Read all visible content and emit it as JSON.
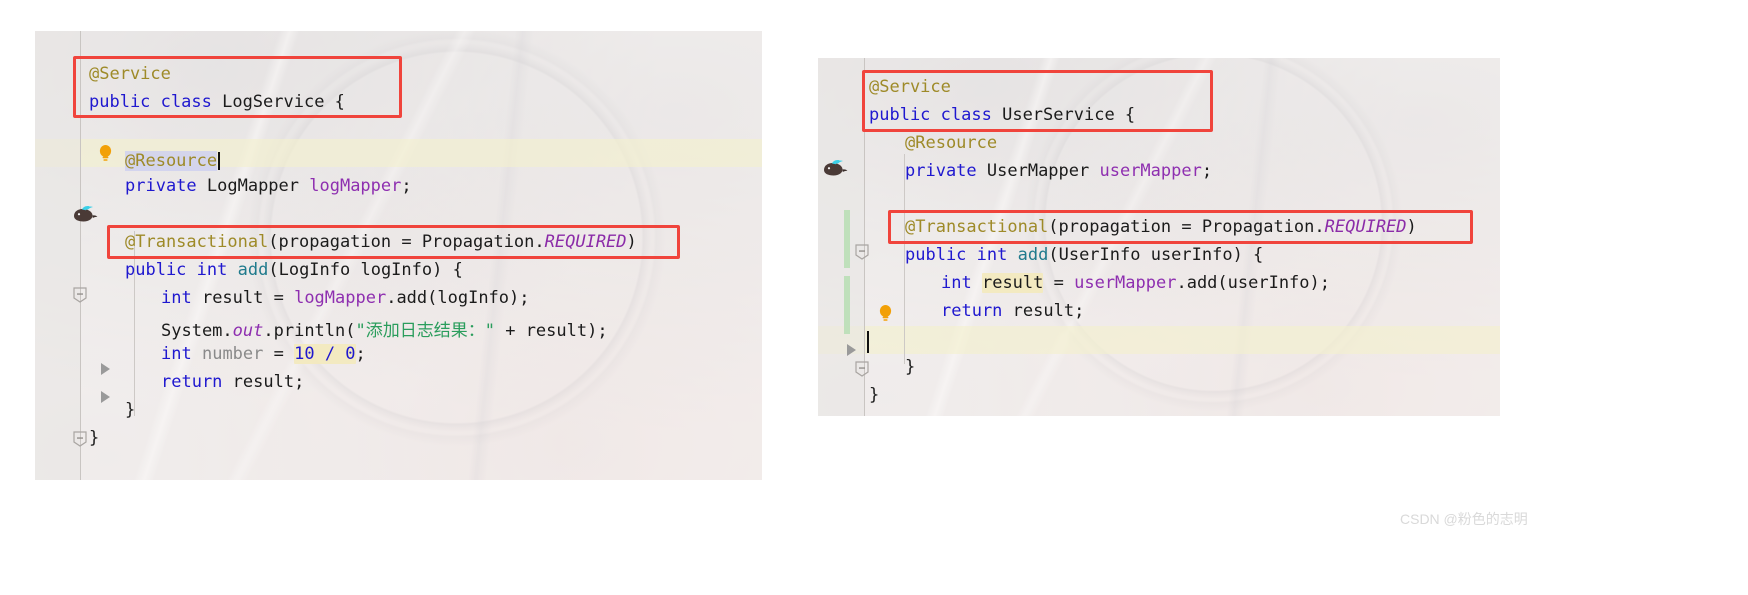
{
  "page": {
    "background": "#ffffff",
    "watermark": "CSDN @粉色的志明",
    "accent_box_color": "#f0443c"
  },
  "panels": [
    {
      "id": "left-editor",
      "name": "log-service-editor",
      "file_class": "LogService",
      "caret_line_index": 2,
      "code_lines": [
        {
          "indent": 0,
          "tokens": [
            {
              "t": "@Service",
              "c": "anno"
            }
          ]
        },
        {
          "indent": 0,
          "tokens": [
            {
              "t": "public",
              "c": "kw"
            },
            {
              "t": " ",
              "c": ""
            },
            {
              "t": "class",
              "c": "kw"
            },
            {
              "t": " LogService {",
              "c": ""
            }
          ]
        },
        {
          "indent": 0,
          "tokens": []
        },
        {
          "indent": 1,
          "tokens": [
            {
              "t": "@Resource",
              "c": "anno sel"
            }
          ]
        },
        {
          "indent": 1,
          "tokens": [
            {
              "t": "private",
              "c": "kw"
            },
            {
              "t": " LogMapper ",
              "c": ""
            },
            {
              "t": "logMapper",
              "c": "ident"
            },
            {
              "t": ";",
              "c": ""
            }
          ]
        },
        {
          "indent": 0,
          "tokens": []
        },
        {
          "indent": 1,
          "tokens": [
            {
              "t": "@Transactional",
              "c": "anno"
            },
            {
              "t": "(propagation = Propagation.",
              "c": ""
            },
            {
              "t": "REQUIRED",
              "c": "req"
            },
            {
              "t": ")",
              "c": ""
            }
          ]
        },
        {
          "indent": 1,
          "tokens": [
            {
              "t": "public",
              "c": "kw"
            },
            {
              "t": " ",
              "c": ""
            },
            {
              "t": "int",
              "c": "kw"
            },
            {
              "t": " ",
              "c": ""
            },
            {
              "t": "add",
              "c": "meth"
            },
            {
              "t": "(LogInfo logInfo) {",
              "c": ""
            }
          ]
        },
        {
          "indent": 2,
          "tokens": [
            {
              "t": "int",
              "c": "kw"
            },
            {
              "t": " result = ",
              "c": ""
            },
            {
              "t": "logMapper",
              "c": "ident"
            },
            {
              "t": ".add(logInfo);",
              "c": ""
            }
          ]
        },
        {
          "indent": 2,
          "tokens": [
            {
              "t": "System.",
              "c": ""
            },
            {
              "t": "out",
              "c": "out"
            },
            {
              "t": ".println(",
              "c": ""
            },
            {
              "t": "\"添加日志结果：\"",
              "c": "str"
            },
            {
              "t": " + result);",
              "c": ""
            }
          ]
        },
        {
          "indent": 2,
          "tokens": [
            {
              "t": "int",
              "c": "kw"
            },
            {
              "t": " ",
              "c": ""
            },
            {
              "t": "number",
              "c": "stat"
            },
            {
              "t": " = ",
              "c": ""
            },
            {
              "t": "10 / 0",
              "c": "hl-expr"
            },
            {
              "t": ";",
              "c": ""
            }
          ]
        },
        {
          "indent": 2,
          "tokens": [
            {
              "t": "return",
              "c": "kw"
            },
            {
              "t": " result;",
              "c": ""
            }
          ]
        },
        {
          "indent": 1,
          "tokens": [
            {
              "t": "}",
              "c": ""
            }
          ]
        },
        {
          "indent": 0,
          "tokens": [
            {
              "t": "}",
              "c": ""
            }
          ]
        }
      ],
      "highlight_boxes": [
        {
          "name": "class-declaration-box",
          "lines": "0-1"
        },
        {
          "name": "transactional-annotation-box",
          "lines": "6"
        }
      ],
      "gutter_icons": [
        {
          "name": "intention-bulb-icon",
          "glyph": "lightbulb",
          "line": 3
        },
        {
          "name": "spring-bean-icon",
          "glyph": "bird",
          "line": 4
        },
        {
          "name": "fold-marker-icon",
          "glyph": "fold",
          "line": 7
        },
        {
          "name": "run-gutter-arrow-icon",
          "glyph": "arrow",
          "line": 10
        },
        {
          "name": "run-gutter-arrow-icon",
          "glyph": "arrow",
          "line": 11
        },
        {
          "name": "fold-marker-icon",
          "glyph": "fold",
          "line": 12
        }
      ]
    },
    {
      "id": "right-editor",
      "name": "user-service-editor",
      "file_class": "UserService",
      "caret_line_index": 7,
      "code_lines": [
        {
          "indent": 0,
          "tokens": [
            {
              "t": "@Service",
              "c": "anno"
            }
          ]
        },
        {
          "indent": 0,
          "tokens": [
            {
              "t": "public",
              "c": "kw"
            },
            {
              "t": " ",
              "c": ""
            },
            {
              "t": "class",
              "c": "kw"
            },
            {
              "t": " UserService {",
              "c": ""
            }
          ]
        },
        {
          "indent": 1,
          "tokens": [
            {
              "t": "@Resource",
              "c": "anno"
            }
          ]
        },
        {
          "indent": 1,
          "tokens": [
            {
              "t": "private",
              "c": "kw"
            },
            {
              "t": " UserMapper ",
              "c": ""
            },
            {
              "t": "userMapper",
              "c": "ident"
            },
            {
              "t": ";",
              "c": ""
            }
          ]
        },
        {
          "indent": 0,
          "tokens": []
        },
        {
          "indent": 1,
          "tokens": [
            {
              "t": "@Transactional",
              "c": "anno"
            },
            {
              "t": "(propagation = Propagation.",
              "c": ""
            },
            {
              "t": "REQUIRED",
              "c": "req"
            },
            {
              "t": ")",
              "c": ""
            }
          ]
        },
        {
          "indent": 1,
          "tokens": [
            {
              "t": "public",
              "c": "kw"
            },
            {
              "t": " ",
              "c": ""
            },
            {
              "t": "int",
              "c": "kw"
            },
            {
              "t": " ",
              "c": ""
            },
            {
              "t": "add",
              "c": "meth"
            },
            {
              "t": "(UserInfo userInfo) {",
              "c": ""
            }
          ]
        },
        {
          "indent": 2,
          "tokens": [
            {
              "t": "int",
              "c": "kw"
            },
            {
              "t": " ",
              "c": ""
            },
            {
              "t": "result",
              "c": "hl-word"
            },
            {
              "t": " = ",
              "c": ""
            },
            {
              "t": "userMapper",
              "c": "ident"
            },
            {
              "t": ".add(userInfo);",
              "c": ""
            }
          ]
        },
        {
          "indent": 2,
          "tokens": [
            {
              "t": "return",
              "c": "kw"
            },
            {
              "t": " result;",
              "c": ""
            }
          ]
        },
        {
          "indent": 2,
          "tokens": []
        },
        {
          "indent": 1,
          "tokens": [
            {
              "t": "}",
              "c": ""
            }
          ]
        },
        {
          "indent": 0,
          "tokens": [
            {
              "t": "}",
              "c": ""
            }
          ]
        }
      ],
      "highlight_boxes": [
        {
          "name": "class-declaration-box",
          "lines": "0-1"
        },
        {
          "name": "transactional-annotation-box",
          "lines": "5"
        }
      ],
      "gutter_icons": [
        {
          "name": "spring-bean-icon",
          "glyph": "bird",
          "line": 3
        },
        {
          "name": "fold-marker-icon",
          "glyph": "fold",
          "line": 6
        },
        {
          "name": "intention-bulb-icon",
          "glyph": "lightbulb",
          "line": 8
        },
        {
          "name": "run-gutter-arrow-icon",
          "glyph": "arrow",
          "line": 9
        },
        {
          "name": "fold-marker-icon",
          "glyph": "fold",
          "line": 10
        }
      ]
    }
  ]
}
